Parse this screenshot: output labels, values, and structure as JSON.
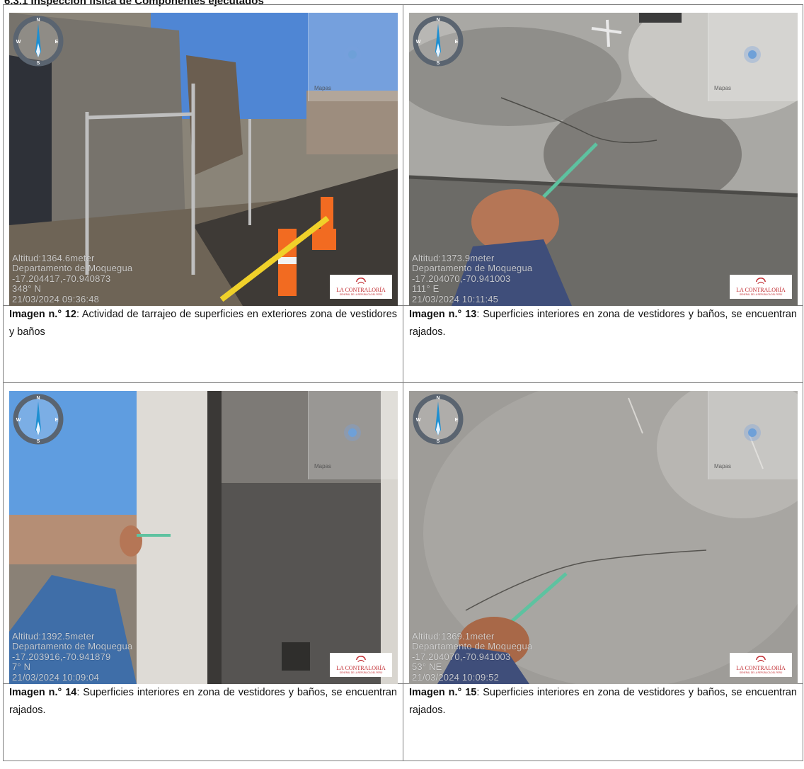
{
  "page_heading": "6.3.1 Inspección física de Componentes ejecutados",
  "logo": {
    "name": "LA CONTRALORÍA",
    "sub": "GENERAL DE LA REPÚBLICA DEL PERÚ"
  },
  "map_overlay_label": "Mapas",
  "images": [
    {
      "label": "Imagen n.° 12",
      "text": ": Actividad de tarrajeo de superficies en exteriores zona de vestidores y baños",
      "stamp": [
        "Altitud:1364.6meter",
        "Departamento de Moquegua",
        "-17.204417,-70.940873",
        "348° N",
        "21/03/2024 09:36:48"
      ]
    },
    {
      "label": "Imagen n.° 13",
      "text": ": Superficies interiores en zona de vestidores y baños, se encuentran rajados.",
      "stamp": [
        "Altitud:1373.9meter",
        "Departamento de Moquegua",
        "-17.204070,-70.941003",
        "111° E",
        "21/03/2024 10:11:45"
      ]
    },
    {
      "label": "Imagen n.° 14",
      "text": ": Superficies interiores en zona de vestidores y baños, se encuentran rajados.",
      "stamp": [
        "Altitud:1392.5meter",
        "Departamento de Moquegua",
        "-17.203916,-70.941879",
        "7° N",
        "21/03/2024 10:09:04"
      ]
    },
    {
      "label": "Imagen n.° 15",
      "text": ": Superficies interiores en zona de vestidores y baños, se encuentran rajados.",
      "stamp": [
        "Altitud:1369.1meter",
        "Departamento de Moquegua",
        "-17.204070,-70.941003",
        "53° NE",
        "21/03/2024 10:09:52"
      ]
    }
  ],
  "compass_letters": {
    "n": "N",
    "e": "E",
    "s": "S",
    "w": "W"
  }
}
